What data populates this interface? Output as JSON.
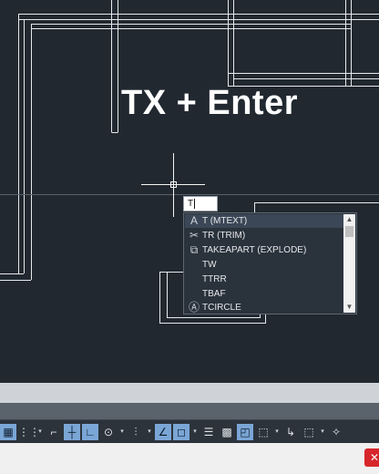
{
  "overlay": {
    "title": "TX + Enter"
  },
  "command_input": {
    "value": "T"
  },
  "autocomplete": {
    "items": [
      {
        "label": "T (MTEXT)",
        "icon": "text-icon",
        "glyph": "A",
        "selected": true
      },
      {
        "label": "TR (TRIM)",
        "icon": "trim-icon",
        "glyph": "✂"
      },
      {
        "label": "TAKEAPART (EXPLODE)",
        "icon": "explode-icon",
        "glyph": "⧉"
      },
      {
        "label": "TW",
        "icon": "",
        "glyph": ""
      },
      {
        "label": "TTRR",
        "icon": "",
        "glyph": ""
      },
      {
        "label": "TBAF",
        "icon": "",
        "glyph": ""
      },
      {
        "label": "TCIRCLE",
        "icon": "circle-icon",
        "glyph": "Ⓐ"
      }
    ]
  },
  "statusbar": {
    "tools": [
      {
        "name": "model-space-icon",
        "glyph": "▦",
        "active": true
      },
      {
        "name": "grid-icon",
        "glyph": "⋮⋮"
      },
      {
        "name": "snap-mode-arrow-icon",
        "glyph": "▾",
        "arrow": true
      },
      {
        "name": "infer-constraints-icon",
        "glyph": "⌐"
      },
      {
        "name": "dynamic-input-icon",
        "glyph": "┼",
        "active": true
      },
      {
        "name": "ortho-mode-icon",
        "glyph": "∟",
        "active": true
      },
      {
        "name": "polar-tracking-icon",
        "glyph": "⊙"
      },
      {
        "name": "polar-arrow-icon",
        "glyph": "▾",
        "arrow": true
      },
      {
        "name": "isodraft-icon",
        "glyph": "⫶"
      },
      {
        "name": "isodraft-arrow-icon",
        "glyph": "▾",
        "arrow": true
      },
      {
        "name": "object-snap-tracking-icon",
        "glyph": "∠",
        "active": true
      },
      {
        "name": "object-snap-icon",
        "glyph": "◻",
        "active": true
      },
      {
        "name": "object-snap-arrow-icon",
        "glyph": "▾",
        "arrow": true
      },
      {
        "name": "lineweight-icon",
        "glyph": "☰"
      },
      {
        "name": "transparency-icon",
        "glyph": "▩"
      },
      {
        "name": "selection-cycling-icon",
        "glyph": "◰",
        "active": true
      },
      {
        "name": "3d-osnap-icon",
        "glyph": "⬚"
      },
      {
        "name": "3d-osnap-arrow-icon",
        "glyph": "▾",
        "arrow": true
      },
      {
        "name": "ucs-icon",
        "glyph": "↳"
      },
      {
        "name": "gizmo-icon",
        "glyph": "⬚"
      },
      {
        "name": "gizmo-arrow-icon",
        "glyph": "▾",
        "arrow": true
      },
      {
        "name": "annotation-icon",
        "glyph": "✧"
      }
    ]
  }
}
